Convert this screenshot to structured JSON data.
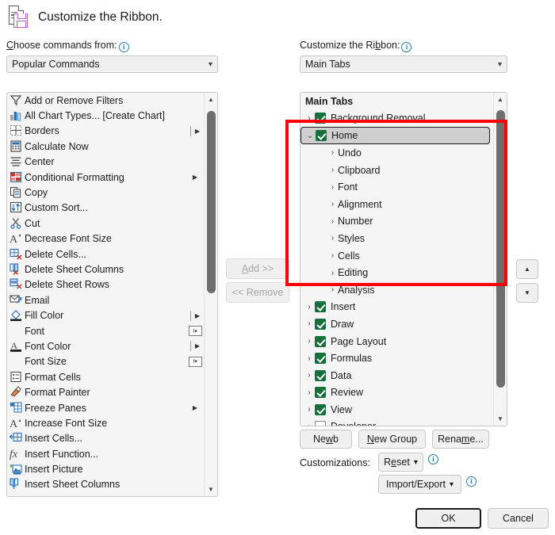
{
  "dialog": {
    "title": "Customize the Ribbon.",
    "title_icon": "document-save-icon"
  },
  "left_panel": {
    "label_prefix": "C",
    "label": "hoose commands from:",
    "info_icon": "info-icon",
    "combo_value": "Popular Commands",
    "commands": [
      {
        "label": "Add or Remove Filters",
        "icon": "filter-icon",
        "tail": ""
      },
      {
        "label": "All Chart Types... [Create Chart]",
        "icon": "bar-chart-icon",
        "tail": ""
      },
      {
        "label": "Borders",
        "icon": "borders-grid-icon",
        "tail": "split"
      },
      {
        "label": "Calculate Now",
        "icon": "calculator-icon",
        "tail": ""
      },
      {
        "label": "Center",
        "icon": "align-center-icon",
        "tail": ""
      },
      {
        "label": "Conditional Formatting",
        "icon": "conditional-formatting-icon",
        "tail": "menu"
      },
      {
        "label": "Copy",
        "icon": "copy-icon",
        "tail": ""
      },
      {
        "label": "Custom Sort...",
        "icon": "sort-icon",
        "tail": ""
      },
      {
        "label": "Cut",
        "icon": "scissors-icon",
        "tail": ""
      },
      {
        "label": "Decrease Font Size",
        "icon": "decrease-font-size-icon",
        "tail": ""
      },
      {
        "label": "Delete Cells...",
        "icon": "delete-cells-icon",
        "tail": ""
      },
      {
        "label": "Delete Sheet Columns",
        "icon": "delete-sheet-columns-icon",
        "tail": ""
      },
      {
        "label": "Delete Sheet Rows",
        "icon": "delete-sheet-rows-icon",
        "tail": ""
      },
      {
        "label": "Email",
        "icon": "email-icon",
        "tail": ""
      },
      {
        "label": "Fill Color",
        "icon": "fill-color-icon",
        "tail": "split"
      },
      {
        "label": "Font",
        "icon": "none",
        "tail": "combo"
      },
      {
        "label": "Font Color",
        "icon": "font-color-icon",
        "tail": "split"
      },
      {
        "label": "Font Size",
        "icon": "none",
        "tail": "combo"
      },
      {
        "label": "Format Cells",
        "icon": "format-cells-icon",
        "tail": ""
      },
      {
        "label": "Format Painter",
        "icon": "format-painter-icon",
        "tail": ""
      },
      {
        "label": "Freeze Panes",
        "icon": "freeze-panes-icon",
        "tail": "menu"
      },
      {
        "label": "Increase Font Size",
        "icon": "increase-font-size-icon",
        "tail": ""
      },
      {
        "label": "Insert Cells...",
        "icon": "insert-cells-icon",
        "tail": ""
      },
      {
        "label": "Insert Function...",
        "icon": "function-icon",
        "tail": ""
      },
      {
        "label": "Insert Picture",
        "icon": "insert-picture-icon",
        "tail": ""
      },
      {
        "label": "Insert Sheet Columns",
        "icon": "insert-sheet-columns-icon",
        "tail": ""
      }
    ]
  },
  "transfer": {
    "add_label": "Add >>",
    "add_underline": "A",
    "remove_label": "<< Remove",
    "add_enabled": false,
    "remove_enabled": false
  },
  "right_panel": {
    "label": "Customize the Ri",
    "label_underline": "b",
    "label_suffix": "bon:",
    "info_icon": "info-icon",
    "combo_value": "Main Tabs",
    "tree_header": "Main Tabs",
    "tree": [
      {
        "label": "Background Removal",
        "level": 0,
        "checked": true,
        "expanded": false,
        "selected": false
      },
      {
        "label": "Home",
        "level": 0,
        "checked": true,
        "expanded": true,
        "selected": true
      },
      {
        "label": "Undo",
        "level": 1,
        "checked": null,
        "expanded": false,
        "selected": false
      },
      {
        "label": "Clipboard",
        "level": 1,
        "checked": null,
        "expanded": false,
        "selected": false
      },
      {
        "label": "Font",
        "level": 1,
        "checked": null,
        "expanded": false,
        "selected": false
      },
      {
        "label": "Alignment",
        "level": 1,
        "checked": null,
        "expanded": false,
        "selected": false
      },
      {
        "label": "Number",
        "level": 1,
        "checked": null,
        "expanded": false,
        "selected": false
      },
      {
        "label": "Styles",
        "level": 1,
        "checked": null,
        "expanded": false,
        "selected": false
      },
      {
        "label": "Cells",
        "level": 1,
        "checked": null,
        "expanded": false,
        "selected": false
      },
      {
        "label": "Editing",
        "level": 1,
        "checked": null,
        "expanded": false,
        "selected": false
      },
      {
        "label": "Analysis",
        "level": 1,
        "checked": null,
        "expanded": false,
        "selected": false
      },
      {
        "label": "Insert",
        "level": 0,
        "checked": true,
        "expanded": false,
        "selected": false
      },
      {
        "label": "Draw",
        "level": 0,
        "checked": true,
        "expanded": false,
        "selected": false
      },
      {
        "label": "Page Layout",
        "level": 0,
        "checked": true,
        "expanded": false,
        "selected": false
      },
      {
        "label": "Formulas",
        "level": 0,
        "checked": true,
        "expanded": false,
        "selected": false
      },
      {
        "label": "Data",
        "level": 0,
        "checked": true,
        "expanded": false,
        "selected": false
      },
      {
        "label": "Review",
        "level": 0,
        "checked": true,
        "expanded": false,
        "selected": false
      },
      {
        "label": "View",
        "level": 0,
        "checked": true,
        "expanded": false,
        "selected": false
      },
      {
        "label": "Developer",
        "level": 0,
        "checked": false,
        "expanded": false,
        "selected": false
      }
    ],
    "move_up_icon": "move-up-arrow-icon",
    "move_down_icon": "move-down-arrow-icon",
    "buttons": {
      "new_tab": "New Tab",
      "new_tab_underline": "w",
      "new_group": "New Group",
      "new_group_underline": "N",
      "rename": "Rename...",
      "rename_underline": "m"
    },
    "customizations_label": "Customizations:",
    "reset_label": "Reset",
    "reset_underline": "e",
    "import_export_label": "Import/Export"
  },
  "footer": {
    "ok_label": "OK",
    "cancel_label": "Cancel"
  },
  "annotation": {
    "color": "#ff0000",
    "shape": "rectangle",
    "target": "home-tab-expanded-groups"
  }
}
